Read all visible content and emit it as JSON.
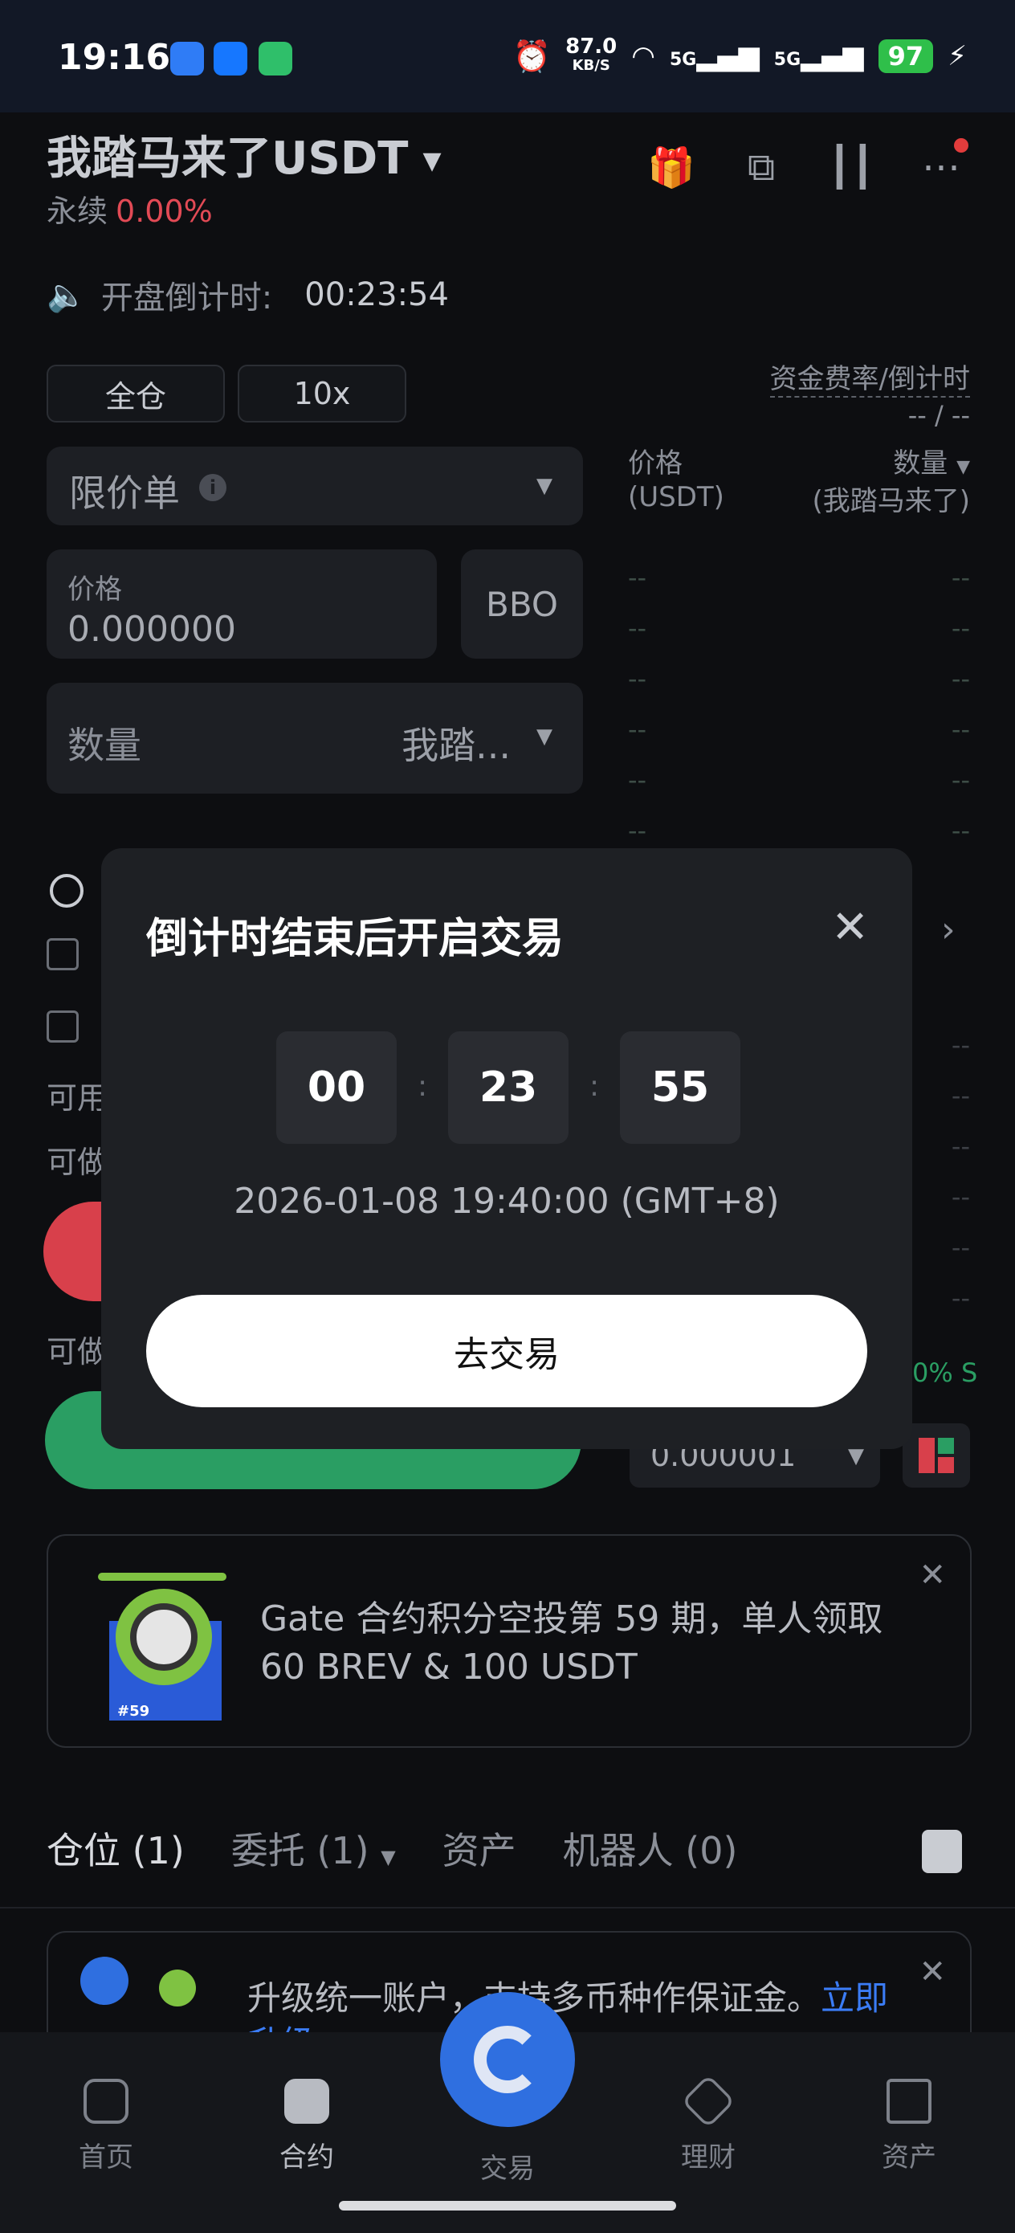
{
  "status_bar": {
    "time": "19:16",
    "net_speed": "87.0",
    "net_unit": "KB/S",
    "signal1": "5G",
    "signal2": "5G",
    "battery": "97"
  },
  "header": {
    "pair": "我踏马来了USDT",
    "contract_type": "永续",
    "change": "0.00%"
  },
  "countdown": {
    "label": "开盘倒计时:",
    "value": "00:23:54"
  },
  "margin": {
    "mode": "全仓",
    "leverage": "10x"
  },
  "funding": {
    "label": "资金费率/倒计时",
    "value": "-- / --"
  },
  "order_form": {
    "order_type": "限价单",
    "price_label": "价格",
    "price_value": "0.000000",
    "bbo": "BBO",
    "qty_label": "数量",
    "qty_unit": "我踏..."
  },
  "orderbook": {
    "price_header": "价格",
    "price_unit": "(USDT)",
    "qty_header": "数量",
    "qty_unit": "(我踏马来了)",
    "placeholder": "--",
    "depth_value": "0.000001",
    "ratio_fragment": "0% S"
  },
  "form_partial": {
    "row1": "可用",
    "row2": "可做",
    "row3": "可做"
  },
  "promo": {
    "text": "Gate 合约积分空投第 59 期，单人领取 60 BREV & 100 USDT",
    "badge": "#59"
  },
  "tabs": [
    {
      "label": "仓位 (1)"
    },
    {
      "label": "委托 (1)"
    },
    {
      "label": "资产"
    },
    {
      "label": "机器人 (0)"
    }
  ],
  "upgrade": {
    "text": "升级统一账户，支持多币种作保证金。",
    "link": "立即升级"
  },
  "bottom_nav": [
    {
      "label": "首页"
    },
    {
      "label": "合约"
    },
    {
      "label": "交易"
    },
    {
      "label": "理财"
    },
    {
      "label": "资产"
    }
  ],
  "modal": {
    "title": "倒计时结束后开启交易",
    "hours": "00",
    "minutes": "23",
    "seconds": "55",
    "separator": ":",
    "datetime": "2026-01-08 19:40:00 (GMT+8)",
    "button": "去交易"
  }
}
